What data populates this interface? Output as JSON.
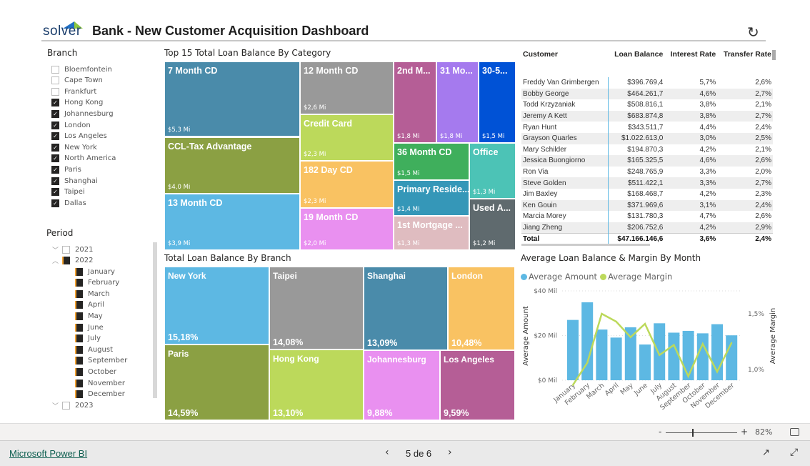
{
  "header": {
    "logo": "solver",
    "title": "Bank - New Customer Acquisition Dashboard",
    "refresh_icon": "refresh-icon"
  },
  "branch_slicer": {
    "title": "Branch",
    "items": [
      {
        "label": "Bloemfontein",
        "checked": false
      },
      {
        "label": "Cape Town",
        "checked": false
      },
      {
        "label": "Frankfurt",
        "checked": false
      },
      {
        "label": "Hong Kong",
        "checked": true
      },
      {
        "label": "Johannesburg",
        "checked": true
      },
      {
        "label": "London",
        "checked": true
      },
      {
        "label": "Los Angeles",
        "checked": true
      },
      {
        "label": "New York",
        "checked": true
      },
      {
        "label": "North America",
        "checked": true
      },
      {
        "label": "Paris",
        "checked": true
      },
      {
        "label": "Shanghai",
        "checked": true
      },
      {
        "label": "Taipei",
        "checked": true
      },
      {
        "label": "Dallas",
        "checked": true
      }
    ]
  },
  "period_slicer": {
    "title": "Period",
    "years": [
      {
        "label": "2021",
        "checked": false,
        "expanded": false
      },
      {
        "label": "2022",
        "checked": true,
        "expanded": true
      },
      {
        "label": "2023",
        "checked": false,
        "expanded": false
      }
    ],
    "months": [
      "January",
      "February",
      "March",
      "April",
      "May",
      "June",
      "July",
      "August",
      "September",
      "October",
      "November",
      "December"
    ]
  },
  "category_treemap": {
    "title": "Top 15 Total Loan Balance By Category",
    "tiles": [
      {
        "label": "7 Month CD",
        "value": "$5,3 Mi",
        "color": "#4A8BAA"
      },
      {
        "label": "CCL-Tax Advantage",
        "value": "$4,0 Mi",
        "color": "#8BA043"
      },
      {
        "label": "13 Month CD",
        "value": "$3,9 Mi",
        "color": "#5DB8E3"
      },
      {
        "label": "12 Month CD",
        "value": "$2,6 Mi",
        "color": "#999999"
      },
      {
        "label": "Credit Card",
        "value": "$2,3 Mi",
        "color": "#BCD95B"
      },
      {
        "label": "182 Day CD",
        "value": "$2,3 Mi",
        "color": "#F9C262"
      },
      {
        "label": "19 Month CD",
        "value": "$2,0 Mi",
        "color": "#E990F0"
      },
      {
        "label": "2nd M...",
        "value": "$1,8 Mi",
        "color": "#B55E96"
      },
      {
        "label": "31 Mo...",
        "value": "$1,8 Mi",
        "color": "#A57AEE"
      },
      {
        "label": "30-5...",
        "value": "$1,5 Mi",
        "color": "#0052D6"
      },
      {
        "label": "36 Month CD",
        "value": "$1,5 Mi",
        "color": "#3FAF5C"
      },
      {
        "label": "Primary Reside...",
        "value": "$1,4 Mi",
        "color": "#3597B8"
      },
      {
        "label": "1st Mortgage ...",
        "value": "$1,3 Mi",
        "color": "#DFBCC0"
      },
      {
        "label": "Office",
        "value": "$1,3 Mi",
        "color": "#4CC3B6"
      },
      {
        "label": "Used A...",
        "value": "$1,2 Mi",
        "color": "#5F6A6E"
      }
    ]
  },
  "branch_treemap": {
    "title": "Total Loan Balance By Branch",
    "tiles": [
      {
        "label": "New York",
        "value": "15,18%",
        "color": "#5DB8E3"
      },
      {
        "label": "Paris",
        "value": "14,59%",
        "color": "#8BA043"
      },
      {
        "label": "Taipei",
        "value": "14,08%",
        "color": "#999999"
      },
      {
        "label": "Hong Kong",
        "value": "13,10%",
        "color": "#BCD95B"
      },
      {
        "label": "Shanghai",
        "value": "13,09%",
        "color": "#4A8BAA"
      },
      {
        "label": "London",
        "value": "10,48%",
        "color": "#F9C262"
      },
      {
        "label": "Johannesburg",
        "value": "9,88%",
        "color": "#E990F0"
      },
      {
        "label": "Los Angeles",
        "value": "9,59%",
        "color": "#B55E96"
      }
    ]
  },
  "customer_table": {
    "columns": [
      "Customer",
      "Loan Balance",
      "Interest Rate",
      "Transfer Rate"
    ],
    "rows": [
      [
        "Freddy Van Grimbergen",
        "$396.769,4",
        "5,7%",
        "2,6%"
      ],
      [
        "Bobby George",
        "$464.261,7",
        "4,6%",
        "2,7%"
      ],
      [
        "Todd Krzyzaniak",
        "$508.816,1",
        "3,8%",
        "2,1%"
      ],
      [
        "Jeremy A Kett",
        "$683.874,8",
        "3,8%",
        "2,7%"
      ],
      [
        "Ryan Hunt",
        "$343.511,7",
        "4,4%",
        "2,4%"
      ],
      [
        "Grayson Quarles",
        "$1.022.613,0",
        "3,0%",
        "2,5%"
      ],
      [
        "Mary Schilder",
        "$194.870,3",
        "4,2%",
        "2,1%"
      ],
      [
        "Jessica Buongiorno",
        "$165.325,5",
        "4,6%",
        "2,6%"
      ],
      [
        "Ron Via",
        "$248.765,9",
        "3,3%",
        "2,0%"
      ],
      [
        "Steve Golden",
        "$511.422,1",
        "3,3%",
        "2,7%"
      ],
      [
        "Jim Baxley",
        "$168.468,7",
        "4,2%",
        "2,3%"
      ],
      [
        "Ken Gouin",
        "$371.969,6",
        "3,1%",
        "2,4%"
      ],
      [
        "Marcia Morey",
        "$131.780,3",
        "4,7%",
        "2,6%"
      ],
      [
        "Jiang Zheng",
        "$206.752,6",
        "4,2%",
        "2,9%"
      ]
    ],
    "total": [
      "Total",
      "$47.166.146,6",
      "3,6%",
      "2,4%"
    ]
  },
  "chart_data": {
    "type": "bar+line",
    "title": "Average Loan Balance & Margin By Month",
    "categories": [
      "January",
      "February",
      "March",
      "April",
      "May",
      "June",
      "July",
      "August",
      "September",
      "October",
      "November",
      "December"
    ],
    "series": [
      {
        "name": "Average Amount",
        "type": "bar",
        "axis": "left",
        "color": "#5DB8E3",
        "values": [
          27.0,
          34.9,
          22.7,
          19.1,
          23.7,
          16.0,
          25.5,
          21.3,
          22.1,
          21.0,
          25.1,
          20.1
        ]
      },
      {
        "name": "Average Margin",
        "type": "line",
        "axis": "right",
        "color": "#BCD95B",
        "values": [
          0.86,
          1.06,
          1.5,
          1.43,
          1.29,
          1.41,
          1.13,
          1.22,
          0.94,
          1.23,
          0.98,
          1.24
        ]
      }
    ],
    "ylabel": "Average Amount",
    "y2label": "Average Margin",
    "yticks": [
      "$0 Mil",
      "$20 Mil",
      "$40 Mil"
    ],
    "ylim": [
      0,
      40
    ],
    "y2ticks": [
      "1,0%",
      "1,5%"
    ],
    "y2lim_note": "percent",
    "legend": "top-left"
  },
  "footer": {
    "zoom": "82%",
    "zoom_minus": "-",
    "zoom_plus": "+",
    "page": "5 de 6",
    "brand_link": "Microsoft Power BI"
  }
}
